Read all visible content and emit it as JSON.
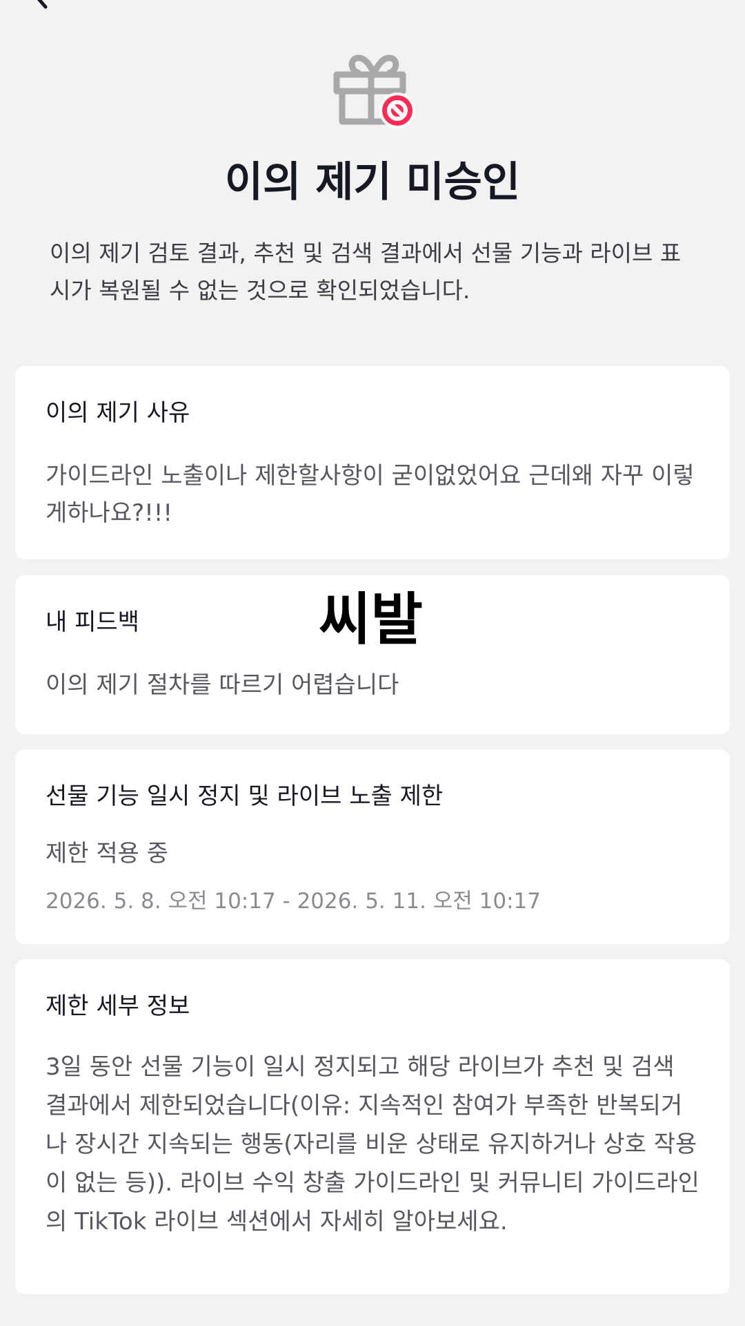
{
  "header": {
    "back_icon": "chevron-left-icon",
    "hero_icon": "gift-blocked-icon",
    "title": "이의 제기 미승인",
    "subtitle": "이의 제기 검토 결과, 추천 및 검색 결과에서 선물 기능과 라이브 표시가 복원될 수 없는 것으로 확인되었습니다."
  },
  "colors": {
    "background": "#f2f2f2",
    "card": "#ffffff",
    "icon_gray": "#a8a8a8",
    "block_red": "#fe2c55"
  },
  "reason_card": {
    "label": "이의 제기 사유",
    "body": "가이드라인 노출이나 제한할사항이 굳이없었어요 근데왜 자꾸 이렇게하나요?!!!"
  },
  "feedback_card": {
    "label": "내 피드백",
    "body": "이의 제기 절차를 따르기 어렵습니다"
  },
  "overlay": {
    "text": "씨발"
  },
  "restriction_card": {
    "label": "선물 기능 일시 정지 및 라이브 노출 제한",
    "status": "제한 적용 중",
    "period": "2026. 5. 8. 오전 10:17 - 2026. 5. 11. 오전 10:17"
  },
  "details_card": {
    "label": "제한 세부 정보",
    "body": "3일 동안 선물 기능이 일시 정지되고 해당 라이브가 추천 및 검색 결과에서 제한되었습니다(이유: 지속적인 참여가 부족한 반복되거나 장시간 지속되는 행동(자리를 비운 상태로 유지하거나 상호 작용이 없는 등)). 라이브 수익 창출 가이드라인 및 커뮤니티 가이드라인의 TikTok 라이브 섹션에서 자세히 알아보세요."
  }
}
